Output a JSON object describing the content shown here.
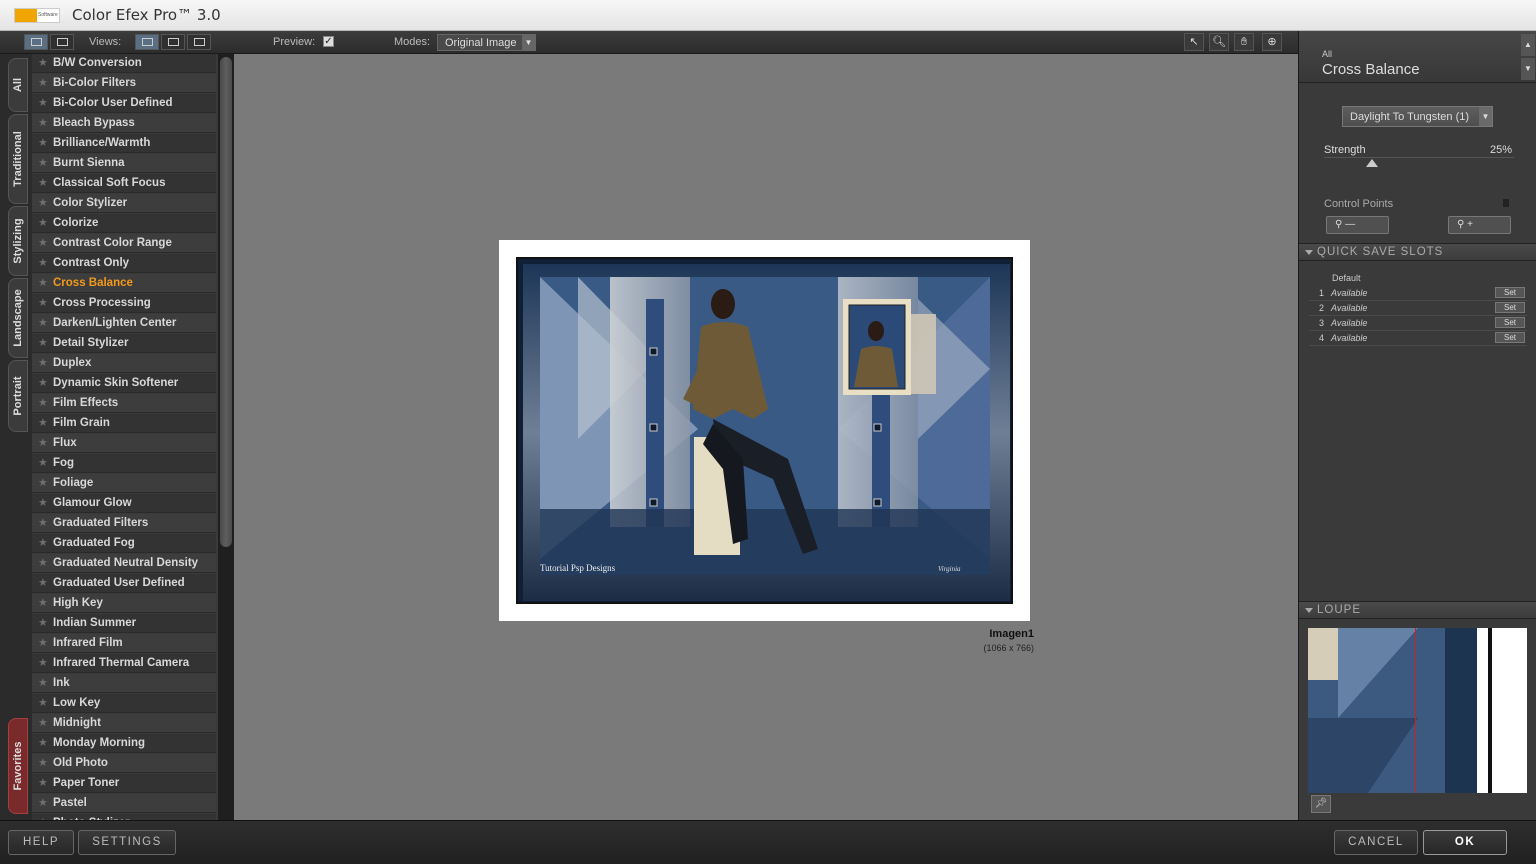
{
  "app": {
    "title": "Color Efex Pro™ 3.0",
    "logo_text": "Software"
  },
  "toolbar": {
    "views_label": "Views:",
    "preview_label": "Preview:",
    "preview_checked": true,
    "modes_label": "Modes:",
    "modes_value": "Original Image"
  },
  "tabs": [
    {
      "label": "All"
    },
    {
      "label": "Traditional"
    },
    {
      "label": "Stylizing"
    },
    {
      "label": "Landscape"
    },
    {
      "label": "Portrait"
    },
    {
      "label": "Favorites"
    }
  ],
  "filters": [
    {
      "label": "B/W Conversion"
    },
    {
      "label": "Bi-Color Filters"
    },
    {
      "label": "Bi-Color User Defined"
    },
    {
      "label": "Bleach Bypass"
    },
    {
      "label": "Brilliance/Warmth"
    },
    {
      "label": "Burnt Sienna"
    },
    {
      "label": "Classical Soft Focus"
    },
    {
      "label": "Color Stylizer"
    },
    {
      "label": "Colorize"
    },
    {
      "label": "Contrast Color Range"
    },
    {
      "label": "Contrast Only"
    },
    {
      "label": "Cross Balance",
      "selected": true
    },
    {
      "label": "Cross Processing"
    },
    {
      "label": "Darken/Lighten Center"
    },
    {
      "label": "Detail Stylizer"
    },
    {
      "label": "Duplex"
    },
    {
      "label": "Dynamic Skin Softener"
    },
    {
      "label": "Film Effects"
    },
    {
      "label": "Film Grain"
    },
    {
      "label": "Flux"
    },
    {
      "label": "Fog"
    },
    {
      "label": "Foliage"
    },
    {
      "label": "Glamour Glow"
    },
    {
      "label": "Graduated Filters"
    },
    {
      "label": "Graduated Fog"
    },
    {
      "label": "Graduated Neutral Density"
    },
    {
      "label": "Graduated User Defined"
    },
    {
      "label": "High Key"
    },
    {
      "label": "Indian Summer"
    },
    {
      "label": "Infrared Film"
    },
    {
      "label": "Infrared Thermal Camera"
    },
    {
      "label": "Ink"
    },
    {
      "label": "Low Key"
    },
    {
      "label": "Midnight"
    },
    {
      "label": "Monday Morning"
    },
    {
      "label": "Old Photo"
    },
    {
      "label": "Paper Toner"
    },
    {
      "label": "Pastel"
    },
    {
      "label": "Photo Stylizer"
    }
  ],
  "image": {
    "name": "Imagen1",
    "size": "(1066 x 766)",
    "watermark_left": "Tutorial Psp Designs",
    "watermark_right": "Virginia"
  },
  "filter_panel": {
    "category": "All",
    "name": "Cross Balance",
    "preset": "Daylight To Tungsten (1)",
    "strength_label": "Strength",
    "strength_value": "25%",
    "strength_fraction": 0.25,
    "control_points_label": "Control Points"
  },
  "quick_save": {
    "title": "QUICK SAVE SLOTS",
    "default_label": "Default",
    "set_label": "Set",
    "slots": [
      {
        "num": "1",
        "status": "Available"
      },
      {
        "num": "2",
        "status": "Available"
      },
      {
        "num": "3",
        "status": "Available"
      },
      {
        "num": "4",
        "status": "Available"
      }
    ]
  },
  "loupe": {
    "title": "LOUPE"
  },
  "buttons": {
    "help": "HELP",
    "settings": "SETTINGS",
    "cancel": "CANCEL",
    "ok": "OK"
  },
  "colors": {
    "accent": "#f39a1c",
    "panel": "#3a3a3a",
    "canvas": "#7a7a7a"
  }
}
